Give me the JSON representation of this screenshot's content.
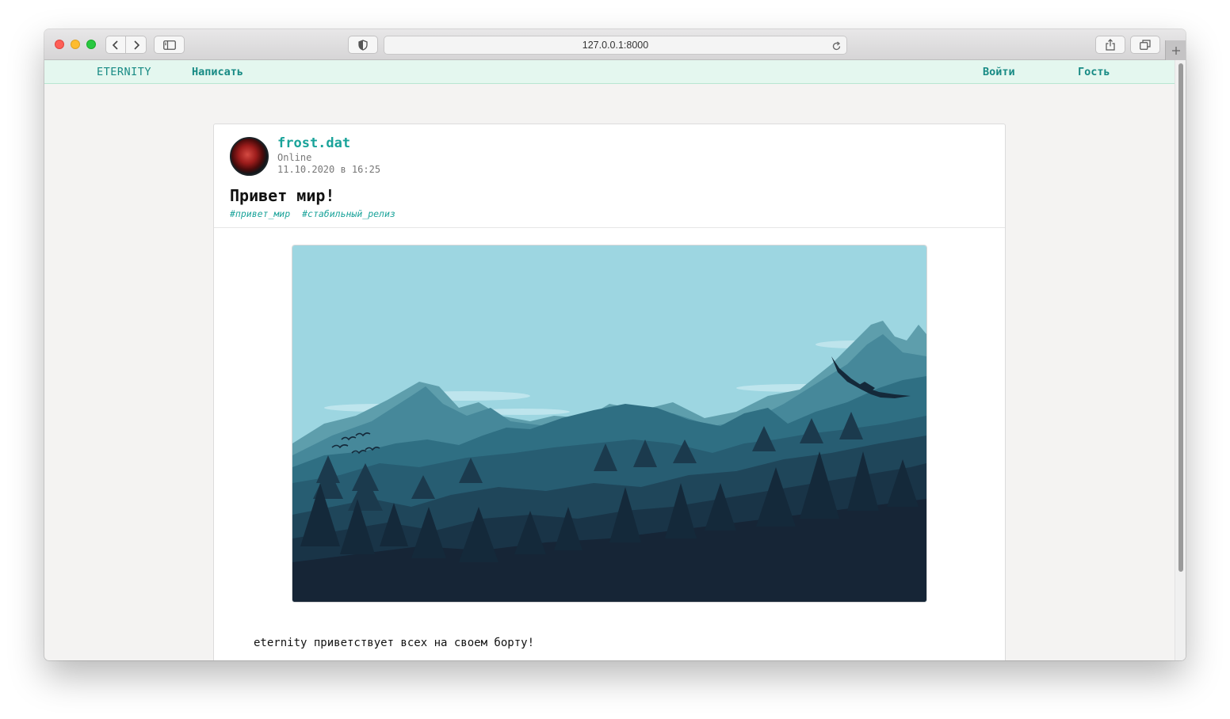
{
  "browser": {
    "url": "127.0.0.1:8000"
  },
  "nav": {
    "brand": "ETERNITY",
    "write": "Написать",
    "login": "Войти",
    "guest": "Гость"
  },
  "post": {
    "author": "frost.dat",
    "status": "Online",
    "date": "11.10.2020 в 16:25",
    "title": "Привет мир!",
    "tags": [
      "#привет_мир",
      "#стабильный_релиз"
    ],
    "body": "eternity приветствует всех на своем борту!"
  },
  "colors": {
    "accent": "#1aa39a",
    "nav_bg": "#e4f7ef",
    "sky": "#9dd6e1",
    "forest_dark": "#162536"
  }
}
